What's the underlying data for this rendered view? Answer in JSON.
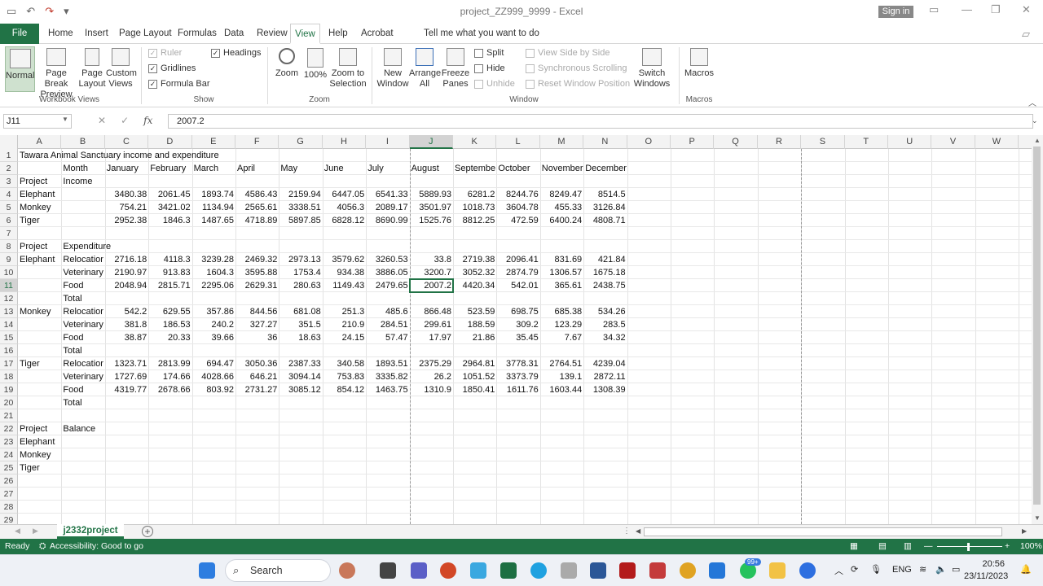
{
  "window": {
    "title": "project_ZZ999_9999  -  Excel",
    "signin_label": "Sign in"
  },
  "tabs": [
    "File",
    "Home",
    "Insert",
    "Page Layout",
    "Formulas",
    "Data",
    "Review",
    "View",
    "Help",
    "Acrobat"
  ],
  "tellme": "Tell me what you want to do",
  "ribbon": {
    "workbook_views": {
      "normal": "Normal",
      "page_break": "Page Break Preview",
      "page_layout": "Page Layout",
      "custom": "Custom Views",
      "group": "Workbook Views"
    },
    "show": {
      "ruler": "Ruler",
      "gridlines": "Gridlines",
      "formula_bar": "Formula Bar",
      "headings": "Headings",
      "group": "Show"
    },
    "zoom": {
      "zoom": "Zoom",
      "hundred": "100%",
      "zoom_sel": "Zoom to Selection",
      "group": "Zoom"
    },
    "window": {
      "new": "New Window",
      "arrange": "Arrange All",
      "freeze": "Freeze Panes",
      "split": "Split",
      "hide": "Hide",
      "unhide": "Unhide",
      "side": "View Side by Side",
      "sync": "Synchronous Scrolling",
      "reset": "Reset Window Position",
      "switch": "Switch Windows",
      "group": "Window"
    },
    "macros": {
      "label": "Macros",
      "group": "Macros"
    }
  },
  "formula_bar": {
    "name_box": "J11",
    "formula": "2007.2",
    "fx": "fx"
  },
  "columns": [
    "A",
    "B",
    "C",
    "D",
    "E",
    "F",
    "G",
    "H",
    "I",
    "J",
    "K",
    "L",
    "M",
    "N",
    "O",
    "P",
    "Q",
    "R",
    "S",
    "T",
    "U",
    "V",
    "W"
  ],
  "rows": [
    "1",
    "2",
    "3",
    "4",
    "5",
    "6",
    "7",
    "8",
    "9",
    "10",
    "11",
    "12",
    "13",
    "14",
    "15",
    "16",
    "17",
    "18",
    "19",
    "20",
    "21",
    "22",
    "23",
    "24",
    "25",
    "26",
    "27",
    "28",
    "29"
  ],
  "cells": [
    {
      "r": 1,
      "c": 0,
      "t": "Tawara Animal Sanctuary income and expenditure"
    },
    {
      "r": 2,
      "c": 1,
      "t": "Month"
    },
    {
      "r": 2,
      "c": 2,
      "t": "January"
    },
    {
      "r": 2,
      "c": 3,
      "t": "February"
    },
    {
      "r": 2,
      "c": 4,
      "t": "March"
    },
    {
      "r": 2,
      "c": 5,
      "t": "April"
    },
    {
      "r": 2,
      "c": 6,
      "t": "May"
    },
    {
      "r": 2,
      "c": 7,
      "t": "June"
    },
    {
      "r": 2,
      "c": 8,
      "t": "July"
    },
    {
      "r": 2,
      "c": 9,
      "t": "August"
    },
    {
      "r": 2,
      "c": 10,
      "t": "Septembe"
    },
    {
      "r": 2,
      "c": 11,
      "t": "October"
    },
    {
      "r": 2,
      "c": 12,
      "t": "November"
    },
    {
      "r": 2,
      "c": 13,
      "t": "December"
    },
    {
      "r": 3,
      "c": 0,
      "t": "Project"
    },
    {
      "r": 3,
      "c": 1,
      "t": "Income"
    },
    {
      "r": 4,
      "c": 0,
      "t": "Elephant"
    },
    {
      "r": 4,
      "c": 2,
      "t": "3480.38",
      "n": 1
    },
    {
      "r": 4,
      "c": 3,
      "t": "2061.45",
      "n": 1
    },
    {
      "r": 4,
      "c": 4,
      "t": "1893.74",
      "n": 1
    },
    {
      "r": 4,
      "c": 5,
      "t": "4586.43",
      "n": 1
    },
    {
      "r": 4,
      "c": 6,
      "t": "2159.94",
      "n": 1
    },
    {
      "r": 4,
      "c": 7,
      "t": "6447.05",
      "n": 1
    },
    {
      "r": 4,
      "c": 8,
      "t": "6541.33",
      "n": 1
    },
    {
      "r": 4,
      "c": 9,
      "t": "5889.93",
      "n": 1
    },
    {
      "r": 4,
      "c": 10,
      "t": "6281.2",
      "n": 1
    },
    {
      "r": 4,
      "c": 11,
      "t": "8244.76",
      "n": 1
    },
    {
      "r": 4,
      "c": 12,
      "t": "8249.47",
      "n": 1
    },
    {
      "r": 4,
      "c": 13,
      "t": "8514.5",
      "n": 1
    },
    {
      "r": 5,
      "c": 0,
      "t": "Monkey"
    },
    {
      "r": 5,
      "c": 2,
      "t": "754.21",
      "n": 1
    },
    {
      "r": 5,
      "c": 3,
      "t": "3421.02",
      "n": 1
    },
    {
      "r": 5,
      "c": 4,
      "t": "1134.94",
      "n": 1
    },
    {
      "r": 5,
      "c": 5,
      "t": "2565.61",
      "n": 1
    },
    {
      "r": 5,
      "c": 6,
      "t": "3338.51",
      "n": 1
    },
    {
      "r": 5,
      "c": 7,
      "t": "4056.3",
      "n": 1
    },
    {
      "r": 5,
      "c": 8,
      "t": "2089.17",
      "n": 1
    },
    {
      "r": 5,
      "c": 9,
      "t": "3501.97",
      "n": 1
    },
    {
      "r": 5,
      "c": 10,
      "t": "1018.73",
      "n": 1
    },
    {
      "r": 5,
      "c": 11,
      "t": "3604.78",
      "n": 1
    },
    {
      "r": 5,
      "c": 12,
      "t": "455.33",
      "n": 1
    },
    {
      "r": 5,
      "c": 13,
      "t": "3126.84",
      "n": 1
    },
    {
      "r": 6,
      "c": 0,
      "t": "Tiger"
    },
    {
      "r": 6,
      "c": 2,
      "t": "2952.38",
      "n": 1
    },
    {
      "r": 6,
      "c": 3,
      "t": "1846.3",
      "n": 1
    },
    {
      "r": 6,
      "c": 4,
      "t": "1487.65",
      "n": 1
    },
    {
      "r": 6,
      "c": 5,
      "t": "4718.89",
      "n": 1
    },
    {
      "r": 6,
      "c": 6,
      "t": "5897.85",
      "n": 1
    },
    {
      "r": 6,
      "c": 7,
      "t": "6828.12",
      "n": 1
    },
    {
      "r": 6,
      "c": 8,
      "t": "8690.99",
      "n": 1
    },
    {
      "r": 6,
      "c": 9,
      "t": "1525.76",
      "n": 1
    },
    {
      "r": 6,
      "c": 10,
      "t": "8812.25",
      "n": 1
    },
    {
      "r": 6,
      "c": 11,
      "t": "472.59",
      "n": 1
    },
    {
      "r": 6,
      "c": 12,
      "t": "6400.24",
      "n": 1
    },
    {
      "r": 6,
      "c": 13,
      "t": "4808.71",
      "n": 1
    },
    {
      "r": 8,
      "c": 0,
      "t": "Project"
    },
    {
      "r": 8,
      "c": 1,
      "t": "Expenditure"
    },
    {
      "r": 9,
      "c": 0,
      "t": "Elephant"
    },
    {
      "r": 9,
      "c": 1,
      "t": "Relocatior"
    },
    {
      "r": 9,
      "c": 2,
      "t": "2716.18",
      "n": 1
    },
    {
      "r": 9,
      "c": 3,
      "t": "4118.3",
      "n": 1
    },
    {
      "r": 9,
      "c": 4,
      "t": "3239.28",
      "n": 1
    },
    {
      "r": 9,
      "c": 5,
      "t": "2469.32",
      "n": 1
    },
    {
      "r": 9,
      "c": 6,
      "t": "2973.13",
      "n": 1
    },
    {
      "r": 9,
      "c": 7,
      "t": "3579.62",
      "n": 1
    },
    {
      "r": 9,
      "c": 8,
      "t": "3260.53",
      "n": 1
    },
    {
      "r": 9,
      "c": 9,
      "t": "33.8",
      "n": 1
    },
    {
      "r": 9,
      "c": 10,
      "t": "2719.38",
      "n": 1
    },
    {
      "r": 9,
      "c": 11,
      "t": "2096.41",
      "n": 1
    },
    {
      "r": 9,
      "c": 12,
      "t": "831.69",
      "n": 1
    },
    {
      "r": 9,
      "c": 13,
      "t": "421.84",
      "n": 1
    },
    {
      "r": 10,
      "c": 1,
      "t": "Veterinary"
    },
    {
      "r": 10,
      "c": 2,
      "t": "2190.97",
      "n": 1
    },
    {
      "r": 10,
      "c": 3,
      "t": "913.83",
      "n": 1
    },
    {
      "r": 10,
      "c": 4,
      "t": "1604.3",
      "n": 1
    },
    {
      "r": 10,
      "c": 5,
      "t": "3595.88",
      "n": 1
    },
    {
      "r": 10,
      "c": 6,
      "t": "1753.4",
      "n": 1
    },
    {
      "r": 10,
      "c": 7,
      "t": "934.38",
      "n": 1
    },
    {
      "r": 10,
      "c": 8,
      "t": "3886.05",
      "n": 1
    },
    {
      "r": 10,
      "c": 9,
      "t": "3200.7",
      "n": 1
    },
    {
      "r": 10,
      "c": 10,
      "t": "3052.32",
      "n": 1
    },
    {
      "r": 10,
      "c": 11,
      "t": "2874.79",
      "n": 1
    },
    {
      "r": 10,
      "c": 12,
      "t": "1306.57",
      "n": 1
    },
    {
      "r": 10,
      "c": 13,
      "t": "1675.18",
      "n": 1
    },
    {
      "r": 11,
      "c": 1,
      "t": "Food"
    },
    {
      "r": 11,
      "c": 2,
      "t": "2048.94",
      "n": 1
    },
    {
      "r": 11,
      "c": 3,
      "t": "2815.71",
      "n": 1
    },
    {
      "r": 11,
      "c": 4,
      "t": "2295.06",
      "n": 1
    },
    {
      "r": 11,
      "c": 5,
      "t": "2629.31",
      "n": 1
    },
    {
      "r": 11,
      "c": 6,
      "t": "280.63",
      "n": 1
    },
    {
      "r": 11,
      "c": 7,
      "t": "1149.43",
      "n": 1
    },
    {
      "r": 11,
      "c": 8,
      "t": "2479.65",
      "n": 1
    },
    {
      "r": 11,
      "c": 9,
      "t": "2007.2",
      "n": 1
    },
    {
      "r": 11,
      "c": 10,
      "t": "4420.34",
      "n": 1
    },
    {
      "r": 11,
      "c": 11,
      "t": "542.01",
      "n": 1
    },
    {
      "r": 11,
      "c": 12,
      "t": "365.61",
      "n": 1
    },
    {
      "r": 11,
      "c": 13,
      "t": "2438.75",
      "n": 1
    },
    {
      "r": 12,
      "c": 1,
      "t": "Total"
    },
    {
      "r": 13,
      "c": 0,
      "t": "Monkey"
    },
    {
      "r": 13,
      "c": 1,
      "t": "Relocatior"
    },
    {
      "r": 13,
      "c": 2,
      "t": "542.2",
      "n": 1
    },
    {
      "r": 13,
      "c": 3,
      "t": "629.55",
      "n": 1
    },
    {
      "r": 13,
      "c": 4,
      "t": "357.86",
      "n": 1
    },
    {
      "r": 13,
      "c": 5,
      "t": "844.56",
      "n": 1
    },
    {
      "r": 13,
      "c": 6,
      "t": "681.08",
      "n": 1
    },
    {
      "r": 13,
      "c": 7,
      "t": "251.3",
      "n": 1
    },
    {
      "r": 13,
      "c": 8,
      "t": "485.6",
      "n": 1
    },
    {
      "r": 13,
      "c": 9,
      "t": "866.48",
      "n": 1
    },
    {
      "r": 13,
      "c": 10,
      "t": "523.59",
      "n": 1
    },
    {
      "r": 13,
      "c": 11,
      "t": "698.75",
      "n": 1
    },
    {
      "r": 13,
      "c": 12,
      "t": "685.38",
      "n": 1
    },
    {
      "r": 13,
      "c": 13,
      "t": "534.26",
      "n": 1
    },
    {
      "r": 14,
      "c": 1,
      "t": "Veterinary"
    },
    {
      "r": 14,
      "c": 2,
      "t": "381.8",
      "n": 1
    },
    {
      "r": 14,
      "c": 3,
      "t": "186.53",
      "n": 1
    },
    {
      "r": 14,
      "c": 4,
      "t": "240.2",
      "n": 1
    },
    {
      "r": 14,
      "c": 5,
      "t": "327.27",
      "n": 1
    },
    {
      "r": 14,
      "c": 6,
      "t": "351.5",
      "n": 1
    },
    {
      "r": 14,
      "c": 7,
      "t": "210.9",
      "n": 1
    },
    {
      "r": 14,
      "c": 8,
      "t": "284.51",
      "n": 1
    },
    {
      "r": 14,
      "c": 9,
      "t": "299.61",
      "n": 1
    },
    {
      "r": 14,
      "c": 10,
      "t": "188.59",
      "n": 1
    },
    {
      "r": 14,
      "c": 11,
      "t": "309.2",
      "n": 1
    },
    {
      "r": 14,
      "c": 12,
      "t": "123.29",
      "n": 1
    },
    {
      "r": 14,
      "c": 13,
      "t": "283.5",
      "n": 1
    },
    {
      "r": 15,
      "c": 1,
      "t": "Food"
    },
    {
      "r": 15,
      "c": 2,
      "t": "38.87",
      "n": 1
    },
    {
      "r": 15,
      "c": 3,
      "t": "20.33",
      "n": 1
    },
    {
      "r": 15,
      "c": 4,
      "t": "39.66",
      "n": 1
    },
    {
      "r": 15,
      "c": 5,
      "t": "36",
      "n": 1
    },
    {
      "r": 15,
      "c": 6,
      "t": "18.63",
      "n": 1
    },
    {
      "r": 15,
      "c": 7,
      "t": "24.15",
      "n": 1
    },
    {
      "r": 15,
      "c": 8,
      "t": "57.47",
      "n": 1
    },
    {
      "r": 15,
      "c": 9,
      "t": "17.97",
      "n": 1
    },
    {
      "r": 15,
      "c": 10,
      "t": "21.86",
      "n": 1
    },
    {
      "r": 15,
      "c": 11,
      "t": "35.45",
      "n": 1
    },
    {
      "r": 15,
      "c": 12,
      "t": "7.67",
      "n": 1
    },
    {
      "r": 15,
      "c": 13,
      "t": "34.32",
      "n": 1
    },
    {
      "r": 16,
      "c": 1,
      "t": "Total"
    },
    {
      "r": 17,
      "c": 0,
      "t": "Tiger"
    },
    {
      "r": 17,
      "c": 1,
      "t": "Relocatior"
    },
    {
      "r": 17,
      "c": 2,
      "t": "1323.71",
      "n": 1
    },
    {
      "r": 17,
      "c": 3,
      "t": "2813.99",
      "n": 1
    },
    {
      "r": 17,
      "c": 4,
      "t": "694.47",
      "n": 1
    },
    {
      "r": 17,
      "c": 5,
      "t": "3050.36",
      "n": 1
    },
    {
      "r": 17,
      "c": 6,
      "t": "2387.33",
      "n": 1
    },
    {
      "r": 17,
      "c": 7,
      "t": "340.58",
      "n": 1
    },
    {
      "r": 17,
      "c": 8,
      "t": "1893.51",
      "n": 1
    },
    {
      "r": 17,
      "c": 9,
      "t": "2375.29",
      "n": 1
    },
    {
      "r": 17,
      "c": 10,
      "t": "2964.81",
      "n": 1
    },
    {
      "r": 17,
      "c": 11,
      "t": "3778.31",
      "n": 1
    },
    {
      "r": 17,
      "c": 12,
      "t": "2764.51",
      "n": 1
    },
    {
      "r": 17,
      "c": 13,
      "t": "4239.04",
      "n": 1
    },
    {
      "r": 18,
      "c": 1,
      "t": "Veterinary"
    },
    {
      "r": 18,
      "c": 2,
      "t": "1727.69",
      "n": 1
    },
    {
      "r": 18,
      "c": 3,
      "t": "174.66",
      "n": 1
    },
    {
      "r": 18,
      "c": 4,
      "t": "4028.66",
      "n": 1
    },
    {
      "r": 18,
      "c": 5,
      "t": "646.21",
      "n": 1
    },
    {
      "r": 18,
      "c": 6,
      "t": "3094.14",
      "n": 1
    },
    {
      "r": 18,
      "c": 7,
      "t": "753.83",
      "n": 1
    },
    {
      "r": 18,
      "c": 8,
      "t": "3335.82",
      "n": 1
    },
    {
      "r": 18,
      "c": 9,
      "t": "26.2",
      "n": 1
    },
    {
      "r": 18,
      "c": 10,
      "t": "1051.52",
      "n": 1
    },
    {
      "r": 18,
      "c": 11,
      "t": "3373.79",
      "n": 1
    },
    {
      "r": 18,
      "c": 12,
      "t": "139.1",
      "n": 1
    },
    {
      "r": 18,
      "c": 13,
      "t": "2872.11",
      "n": 1
    },
    {
      "r": 19,
      "c": 1,
      "t": "Food"
    },
    {
      "r": 19,
      "c": 2,
      "t": "4319.77",
      "n": 1
    },
    {
      "r": 19,
      "c": 3,
      "t": "2678.66",
      "n": 1
    },
    {
      "r": 19,
      "c": 4,
      "t": "803.92",
      "n": 1
    },
    {
      "r": 19,
      "c": 5,
      "t": "2731.27",
      "n": 1
    },
    {
      "r": 19,
      "c": 6,
      "t": "3085.12",
      "n": 1
    },
    {
      "r": 19,
      "c": 7,
      "t": "854.12",
      "n": 1
    },
    {
      "r": 19,
      "c": 8,
      "t": "1463.75",
      "n": 1
    },
    {
      "r": 19,
      "c": 9,
      "t": "1310.9",
      "n": 1
    },
    {
      "r": 19,
      "c": 10,
      "t": "1850.41",
      "n": 1
    },
    {
      "r": 19,
      "c": 11,
      "t": "1611.76",
      "n": 1
    },
    {
      "r": 19,
      "c": 12,
      "t": "1603.44",
      "n": 1
    },
    {
      "r": 19,
      "c": 13,
      "t": "1308.39",
      "n": 1
    },
    {
      "r": 20,
      "c": 1,
      "t": "Total"
    },
    {
      "r": 22,
      "c": 0,
      "t": "Project"
    },
    {
      "r": 22,
      "c": 1,
      "t": "Balance"
    },
    {
      "r": 23,
      "c": 0,
      "t": "Elephant"
    },
    {
      "r": 24,
      "c": 0,
      "t": "Monkey"
    },
    {
      "r": 25,
      "c": 0,
      "t": "Tiger"
    }
  ],
  "sheet_tab": "j2332project",
  "status": {
    "ready": "Ready",
    "accessibility": "Accessibility: Good to go",
    "zoom": "100%"
  },
  "taskbar": {
    "search": "Search",
    "badge": "99+",
    "lang": "ENG",
    "time": "20:56",
    "date": "23/11/2023"
  }
}
